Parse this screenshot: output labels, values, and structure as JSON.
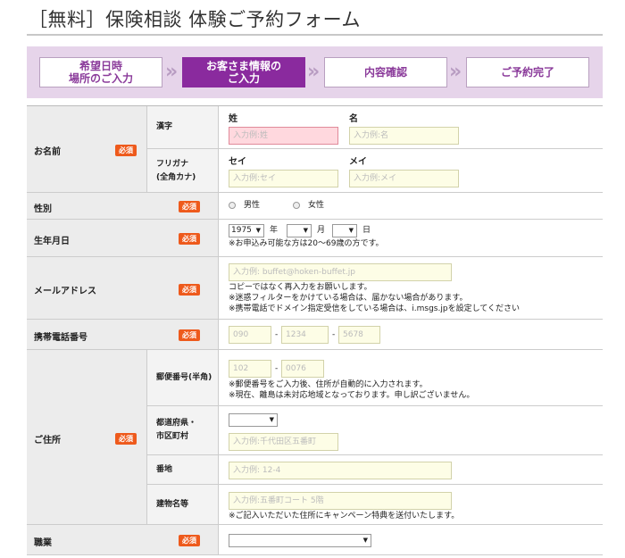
{
  "page": {
    "title": "［無料］保険相談 体験ご予約フォーム"
  },
  "steps": [
    {
      "line1": "希望日時",
      "line2": "場所のご入力"
    },
    {
      "line1": "お客さま情報の",
      "line2": "ご入力"
    },
    {
      "line1": "内容確認",
      "line2": ""
    },
    {
      "line1": "ご予約完了",
      "line2": ""
    }
  ],
  "required_label": "必須",
  "name": {
    "label": "お名前",
    "kanji_label": "漢字",
    "kana_label_1": "フリガナ",
    "kana_label_2": "(全角カナ)",
    "sei_label": "姓",
    "mei_label": "名",
    "sei_placeholder": "入力例:姓",
    "mei_placeholder": "入力例:名",
    "sei_kana_label": "セイ",
    "mei_kana_label": "メイ",
    "sei_kana_placeholder": "入力例:セイ",
    "mei_kana_placeholder": "入力例:メイ"
  },
  "gender": {
    "label": "性別",
    "male": "男性",
    "female": "女性"
  },
  "birth": {
    "label": "生年月日",
    "year_value": "1975",
    "year_unit": "年",
    "month_unit": "月",
    "day_unit": "日",
    "note": "※お申込み可能な方は20～69歳の方です。"
  },
  "email": {
    "label": "メールアドレス",
    "placeholder": "入力例: buffet@hoken-buffet.jp",
    "note1": "コピーではなく再入力をお願いします。",
    "note2": "※迷惑フィルターをかけている場合は、届かない場合があります。",
    "note3": "※携帯電話でドメイン指定受信をしている場合は、i.msgs.jpを設定してください"
  },
  "phone": {
    "label": "携帯電話番号",
    "p1": "090",
    "p2": "1234",
    "p3": "5678",
    "dash": "-"
  },
  "address": {
    "label": "ご住所",
    "postal_label": "郵便番号(半角)",
    "postal1": "102",
    "postal2": "0076",
    "postal_note1": "※郵便番号をご入力後、住所が自動的に入力されます。",
    "postal_note2": "※現在、離島は未対応地域となっております。申し訳ございません。",
    "pref_label1": "都道府県・",
    "pref_label2": "市区町村",
    "city_placeholder": "入力例:千代田区五番町",
    "banchi_label": "番地",
    "banchi_placeholder": "入力例: 12-4",
    "building_label": "建物名等",
    "building_placeholder": "入力例:五番町コート 5階",
    "building_note": "※ご記入いただいた住所にキャンペーン特典を送付いたします。"
  },
  "job": {
    "label": "職業"
  }
}
